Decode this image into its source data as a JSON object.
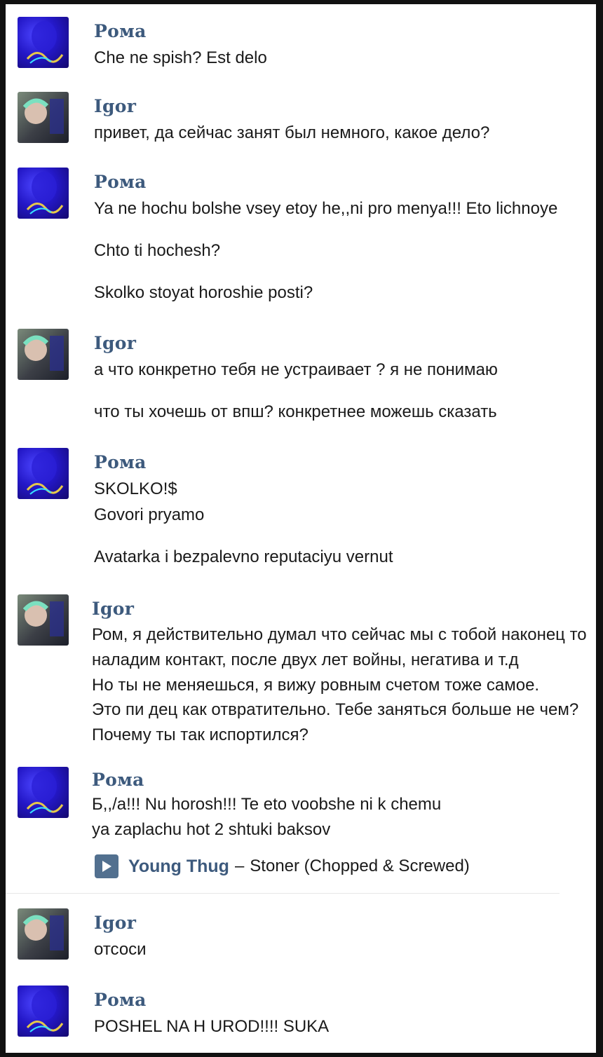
{
  "messages": [
    {
      "author": "Рома",
      "lines": [
        "Che ne spish? Est delo"
      ]
    },
    {
      "author": "Igor",
      "lines": [
        "привет, да сейчас занят был немного, какое дело?"
      ]
    },
    {
      "author": "Рома",
      "lines": [
        "Ya ne hochu bolshe vsey etoy he,,ni pro menya!!! Eto lichnoye",
        "Chto ti hochesh?",
        "Skolko stoyat horoshie posti?"
      ]
    },
    {
      "author": "Igor",
      "lines": [
        "а что конкретно тебя не устраивает ? я не понимаю",
        "что ты хочешь от впш? конкретнее можешь сказать"
      ]
    },
    {
      "author": "Рома",
      "lines": [
        "SKOLKO!$",
        "Govori pryamo",
        "Avatarka i bezpalevno reputaciyu vernut"
      ]
    },
    {
      "author": "Igor",
      "lines": [
        "Ром, я действительно думал что сейчас мы с тобой наконец то",
        "наладим контакт, после двух лет войны, негатива и т.д",
        "Но ты не меняешься, я вижу ровным счетом тоже самое.",
        "Это пи   дец как отвратительно. Тебе заняться больше не чем?",
        "Почему ты так испортился?"
      ]
    },
    {
      "author": "Рома",
      "lines": [
        "Б,,/а!!! Nu horosh!!! Te eto voobshe ni k chemu",
        "ya zaplachu hot 2 shtuki baksov"
      ]
    },
    {
      "author": "Igor",
      "lines": [
        "отсоси"
      ]
    },
    {
      "author": "Рома",
      "lines": [
        "POSHEL NA H    UROD!!!! SUKA"
      ]
    }
  ],
  "audio": {
    "artist": "Young Thug",
    "separator": "–",
    "title": "Stoner (Chopped & Screwed)",
    "icon": "play-icon"
  },
  "colors": {
    "name": "#3d5a7d",
    "text": "#1a1a1a",
    "play_button": "#52708f"
  }
}
